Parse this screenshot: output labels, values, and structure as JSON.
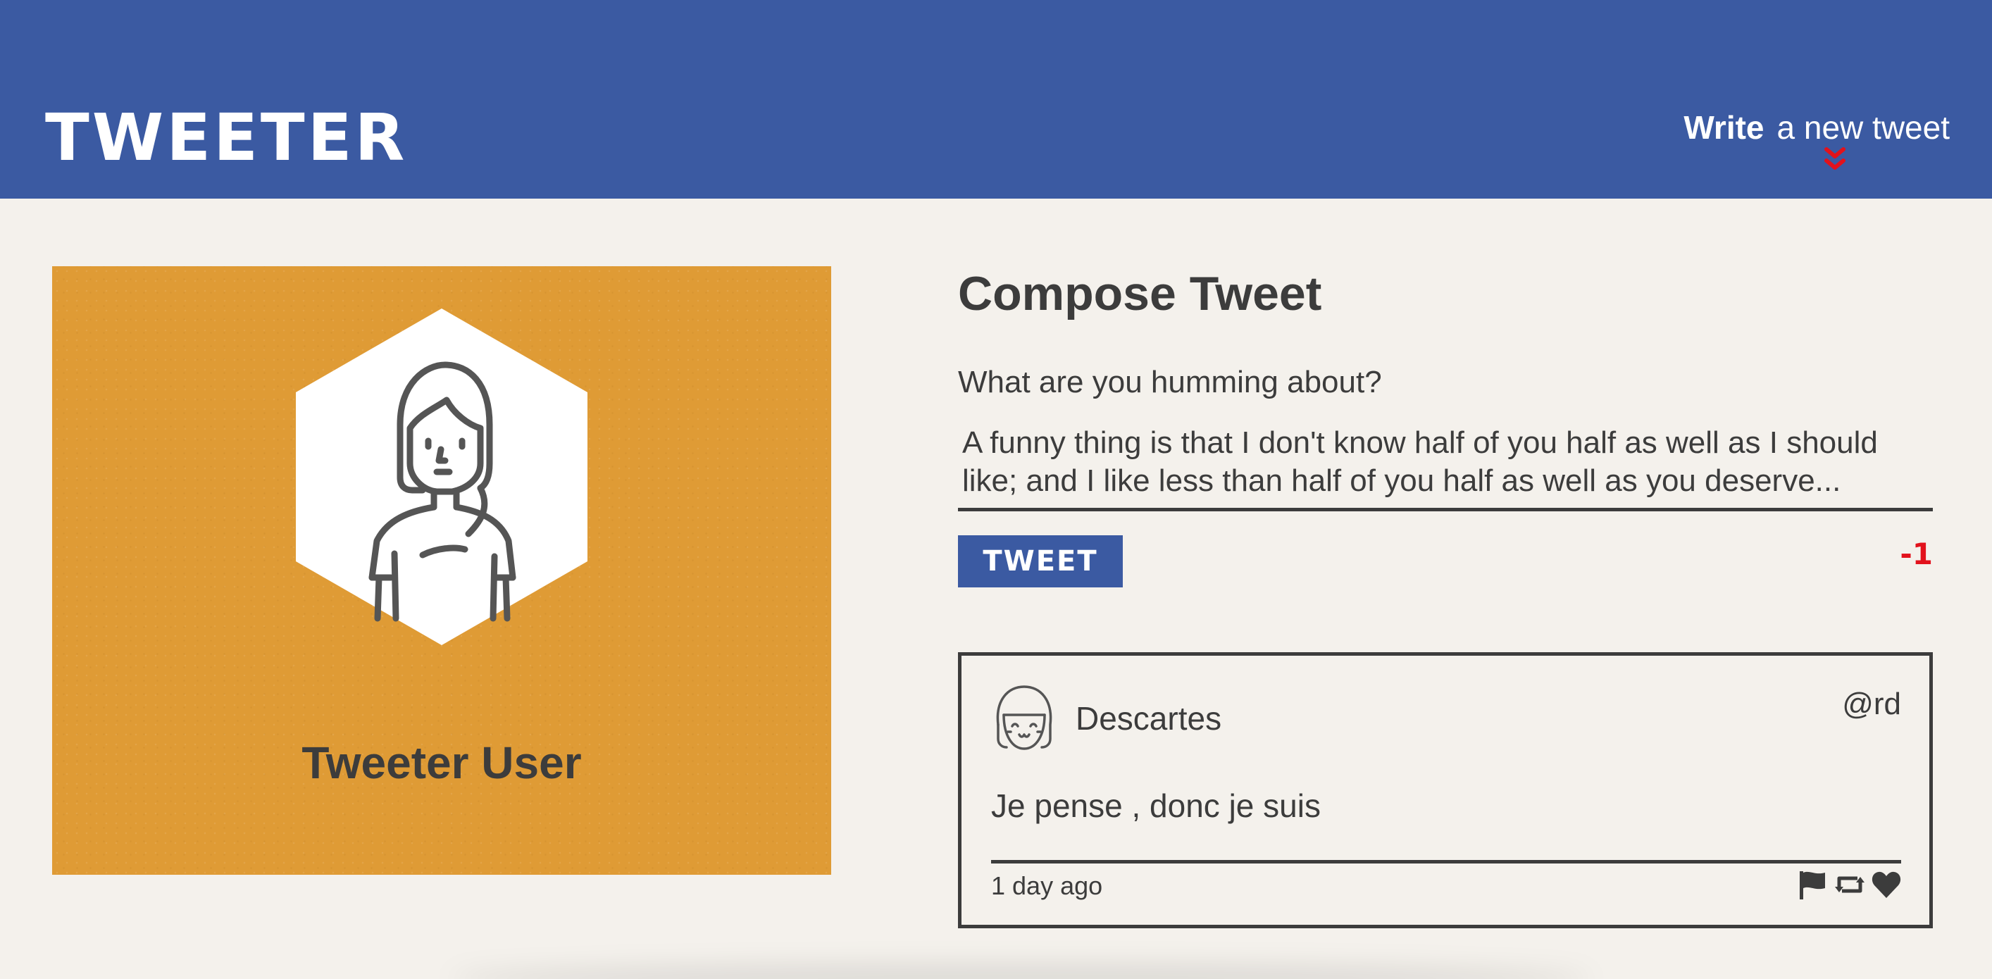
{
  "nav": {
    "brand": "TWEETER",
    "write_strong": "Write",
    "write_rest": "a new tweet",
    "chevron_icon": "double-chevron-down",
    "chevron_color": "#e2121c"
  },
  "profile": {
    "name": "Tweeter User",
    "card_color": "#df9b35",
    "avatar_icon": "girl-avatar"
  },
  "compose": {
    "title": "Compose Tweet",
    "label": "What are you humming about?",
    "text": "A funny thing is that I don't know half of you half as well as I should like; and I like less than half of you half as well as you deserve...",
    "button_label": "TWEET",
    "counter": "-1",
    "counter_color": "#e2121c",
    "button_color": "#3b5aa2"
  },
  "tweet": {
    "author": "Descartes",
    "handle": "@rd",
    "body": "Je pense , donc je suis",
    "time": "1 day ago",
    "avatar_icon": "smiling-face-avatar",
    "actions": [
      "flag-icon",
      "retweet-icon",
      "heart-icon"
    ]
  },
  "colors": {
    "header": "#3b5aa2",
    "background": "#f4f1ec",
    "text": "#3c3c3c"
  }
}
